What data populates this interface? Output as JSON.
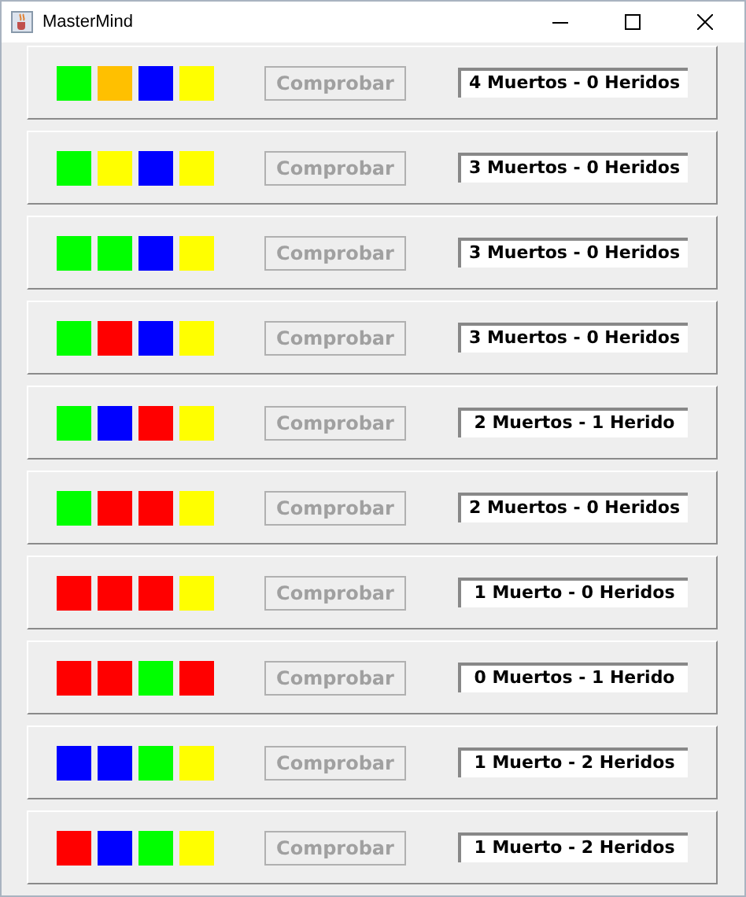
{
  "window": {
    "title": "MasterMind"
  },
  "rows": [
    {
      "pegs": [
        {
          "color": "#00ff00"
        },
        {
          "color": "#ffc000"
        },
        {
          "color": "#0000ff"
        },
        {
          "color": "#ffff00"
        }
      ],
      "button": {
        "label": "Comprobar",
        "disabled": true
      },
      "result": "4 Muertos - 0 Heridos"
    },
    {
      "pegs": [
        {
          "color": "#00ff00"
        },
        {
          "color": "#ffff00"
        },
        {
          "color": "#0000ff"
        },
        {
          "color": "#ffff00"
        }
      ],
      "button": {
        "label": "Comprobar",
        "disabled": true
      },
      "result": "3 Muertos - 0 Heridos"
    },
    {
      "pegs": [
        {
          "color": "#00ff00"
        },
        {
          "color": "#00ff00"
        },
        {
          "color": "#0000ff"
        },
        {
          "color": "#ffff00"
        }
      ],
      "button": {
        "label": "Comprobar",
        "disabled": true
      },
      "result": "3 Muertos - 0 Heridos"
    },
    {
      "pegs": [
        {
          "color": "#00ff00"
        },
        {
          "color": "#ff0000"
        },
        {
          "color": "#0000ff"
        },
        {
          "color": "#ffff00"
        }
      ],
      "button": {
        "label": "Comprobar",
        "disabled": true
      },
      "result": "3 Muertos - 0 Heridos"
    },
    {
      "pegs": [
        {
          "color": "#00ff00"
        },
        {
          "color": "#0000ff"
        },
        {
          "color": "#ff0000"
        },
        {
          "color": "#ffff00"
        }
      ],
      "button": {
        "label": "Comprobar",
        "disabled": true
      },
      "result": "2 Muertos - 1 Herido"
    },
    {
      "pegs": [
        {
          "color": "#00ff00"
        },
        {
          "color": "#ff0000"
        },
        {
          "color": "#ff0000"
        },
        {
          "color": "#ffff00"
        }
      ],
      "button": {
        "label": "Comprobar",
        "disabled": true
      },
      "result": "2 Muertos - 0 Heridos"
    },
    {
      "pegs": [
        {
          "color": "#ff0000"
        },
        {
          "color": "#ff0000"
        },
        {
          "color": "#ff0000"
        },
        {
          "color": "#ffff00"
        }
      ],
      "button": {
        "label": "Comprobar",
        "disabled": true
      },
      "result": "1 Muerto - 0 Heridos"
    },
    {
      "pegs": [
        {
          "color": "#ff0000"
        },
        {
          "color": "#ff0000"
        },
        {
          "color": "#00ff00"
        },
        {
          "color": "#ff0000"
        }
      ],
      "button": {
        "label": "Comprobar",
        "disabled": true
      },
      "result": "0 Muertos - 1 Herido"
    },
    {
      "pegs": [
        {
          "color": "#0000ff"
        },
        {
          "color": "#0000ff"
        },
        {
          "color": "#00ff00"
        },
        {
          "color": "#ffff00"
        }
      ],
      "button": {
        "label": "Comprobar",
        "disabled": true
      },
      "result": "1 Muerto - 2 Heridos"
    },
    {
      "pegs": [
        {
          "color": "#ff0000"
        },
        {
          "color": "#0000ff"
        },
        {
          "color": "#00ff00"
        },
        {
          "color": "#ffff00"
        }
      ],
      "button": {
        "label": "Comprobar",
        "disabled": true
      },
      "result": "1 Muerto - 2 Heridos"
    }
  ]
}
